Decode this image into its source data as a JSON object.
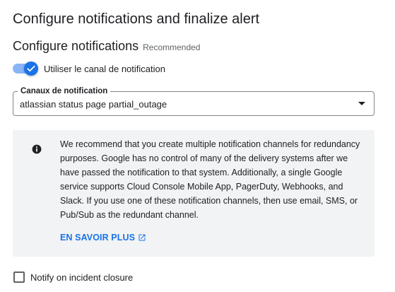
{
  "page": {
    "title": "Configure notifications and finalize alert"
  },
  "section": {
    "title": "Configure notifications",
    "badge": "Recommended"
  },
  "toggle": {
    "label": "Utiliser le canal de notification",
    "checked": true,
    "color": "#1a73e8"
  },
  "channels_select": {
    "label": "Canaux de notification",
    "value": "atlassian status page partial_outage"
  },
  "info_box": {
    "icon": "info-icon",
    "text": "We recommend that you create multiple notification channels for redundancy purposes. Google has no control of many of the delivery systems after we have passed the notification to that system. Additionally, a single Google service supports Cloud Console Mobile App, PagerDuty, Webhooks, and Slack. If you use one of these notification channels, then use email, SMS, or Pub/Sub as the redundant channel.",
    "link_label": "EN SAVOIR PLUS",
    "link_icon": "open-in-new-icon",
    "link_color": "#1a73e8",
    "background": "#f1f3f4"
  },
  "incident_closure": {
    "label": "Notify on incident closure",
    "checked": false
  }
}
